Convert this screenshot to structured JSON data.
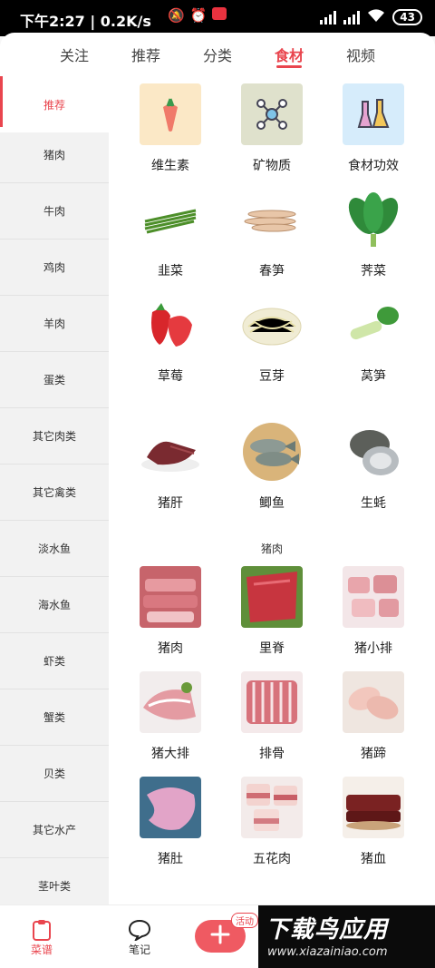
{
  "status_bar": {
    "time": "下午2:27",
    "speed": "0.2K/s",
    "battery": "43"
  },
  "top_tabs": [
    "关注",
    "推荐",
    "分类",
    "食材",
    "视频"
  ],
  "active_tab": "食材",
  "sidebar": {
    "items": [
      "推荐",
      "猪肉",
      "牛肉",
      "鸡肉",
      "羊肉",
      "蛋类",
      "其它肉类",
      "其它禽类",
      "淡水鱼",
      "海水鱼",
      "虾类",
      "蟹类",
      "贝类",
      "其它水产",
      "茎叶类"
    ],
    "active": "推荐"
  },
  "grid": {
    "top_categories": [
      {
        "label": "维生素",
        "icon": "carrot-icon"
      },
      {
        "label": "矿物质",
        "icon": "molecule-icon"
      },
      {
        "label": "食材功效",
        "icon": "flask-icon"
      }
    ],
    "vegetables": [
      {
        "label": "韭菜",
        "icon": "chives-icon"
      },
      {
        "label": "春笋",
        "icon": "bamboo-shoot-icon"
      },
      {
        "label": "荠菜",
        "icon": "leafy-greens-icon"
      },
      {
        "label": "草莓",
        "icon": "strawberry-icon"
      },
      {
        "label": "豆芽",
        "icon": "bean-sprouts-icon"
      },
      {
        "label": "莴笋",
        "icon": "lettuce-stem-icon"
      },
      {
        "label": "猪肝",
        "icon": "pork-liver-icon"
      },
      {
        "label": "鲫鱼",
        "icon": "crucian-fish-icon"
      },
      {
        "label": "生蚝",
        "icon": "oyster-icon"
      }
    ],
    "section_title": "猪肉",
    "pork": [
      {
        "label": "猪肉",
        "icon": "pork-icon"
      },
      {
        "label": "里脊",
        "icon": "tenderloin-icon"
      },
      {
        "label": "猪小排",
        "icon": "small-ribs-icon"
      },
      {
        "label": "猪大排",
        "icon": "pork-chop-icon"
      },
      {
        "label": "排骨",
        "icon": "spare-ribs-icon"
      },
      {
        "label": "猪蹄",
        "icon": "trotter-icon"
      },
      {
        "label": "猪肚",
        "icon": "pork-tripe-icon"
      },
      {
        "label": "五花肉",
        "icon": "pork-belly-icon"
      },
      {
        "label": "猪血",
        "icon": "pork-blood-icon"
      }
    ]
  },
  "bottom_nav": {
    "recipes": "菜谱",
    "notes": "笔记",
    "promo_badge": "活动"
  },
  "watermark": {
    "title": "下载鸟应用",
    "url": "www.xiazainiao.com"
  },
  "colors": {
    "accent": "#e9454e"
  }
}
